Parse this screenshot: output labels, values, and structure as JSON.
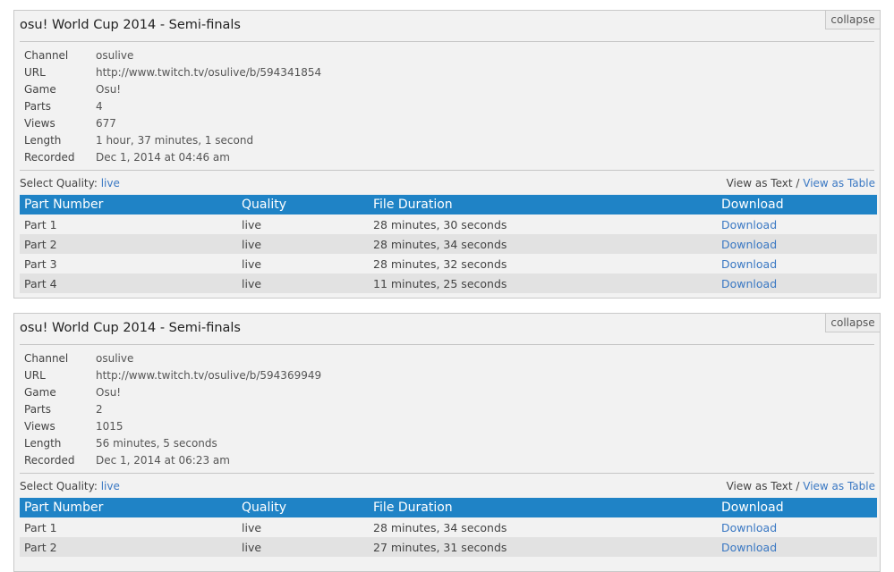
{
  "panels": [
    {
      "title": "osu! World Cup 2014 - Semi-finals",
      "collapse_label": "collapse",
      "meta": [
        {
          "key": "Channel",
          "value": "osulive"
        },
        {
          "key": "URL",
          "value": "http://www.twitch.tv/osulive/b/594341854"
        },
        {
          "key": "Game",
          "value": "Osu!"
        },
        {
          "key": "Parts",
          "value": "4"
        },
        {
          "key": "Views",
          "value": "677"
        },
        {
          "key": "Length",
          "value": "1 hour, 37 minutes, 1 second"
        },
        {
          "key": "Recorded",
          "value": "Dec 1, 2014 at 04:46 am"
        }
      ],
      "select_quality_label": "Select Quality:",
      "select_quality_value": "live",
      "view_as_text": "View as Text",
      "view_separator": "/",
      "view_as_table": "View as Table",
      "columns": [
        "Part Number",
        "Quality",
        "File Duration",
        "Download"
      ],
      "rows": [
        {
          "part": "Part 1",
          "quality": "live",
          "duration": "28 minutes, 30 seconds",
          "download": "Download"
        },
        {
          "part": "Part 2",
          "quality": "live",
          "duration": "28 minutes, 34 seconds",
          "download": "Download"
        },
        {
          "part": "Part 3",
          "quality": "live",
          "duration": "28 minutes, 32 seconds",
          "download": "Download"
        },
        {
          "part": "Part 4",
          "quality": "live",
          "duration": "11 minutes, 25 seconds",
          "download": "Download"
        }
      ]
    },
    {
      "title": "osu! World Cup 2014 - Semi-finals",
      "collapse_label": "collapse",
      "meta": [
        {
          "key": "Channel",
          "value": "osulive"
        },
        {
          "key": "URL",
          "value": "http://www.twitch.tv/osulive/b/594369949"
        },
        {
          "key": "Game",
          "value": "Osu!"
        },
        {
          "key": "Parts",
          "value": "2"
        },
        {
          "key": "Views",
          "value": "1015"
        },
        {
          "key": "Length",
          "value": "56 minutes, 5 seconds"
        },
        {
          "key": "Recorded",
          "value": "Dec 1, 2014 at 06:23 am"
        }
      ],
      "select_quality_label": "Select Quality:",
      "select_quality_value": "live",
      "view_as_text": "View as Text",
      "view_separator": "/",
      "view_as_table": "View as Table",
      "columns": [
        "Part Number",
        "Quality",
        "File Duration",
        "Download"
      ],
      "rows": [
        {
          "part": "Part 1",
          "quality": "live",
          "duration": "28 minutes, 34 seconds",
          "download": "Download"
        },
        {
          "part": "Part 2",
          "quality": "live",
          "duration": "27 minutes, 31 seconds",
          "download": "Download"
        }
      ]
    }
  ],
  "colors": {
    "table_header": "#1f83c6",
    "link": "#3a78c3",
    "panel_bg": "#f2f2f2",
    "row_alt": "#e2e2e2"
  }
}
